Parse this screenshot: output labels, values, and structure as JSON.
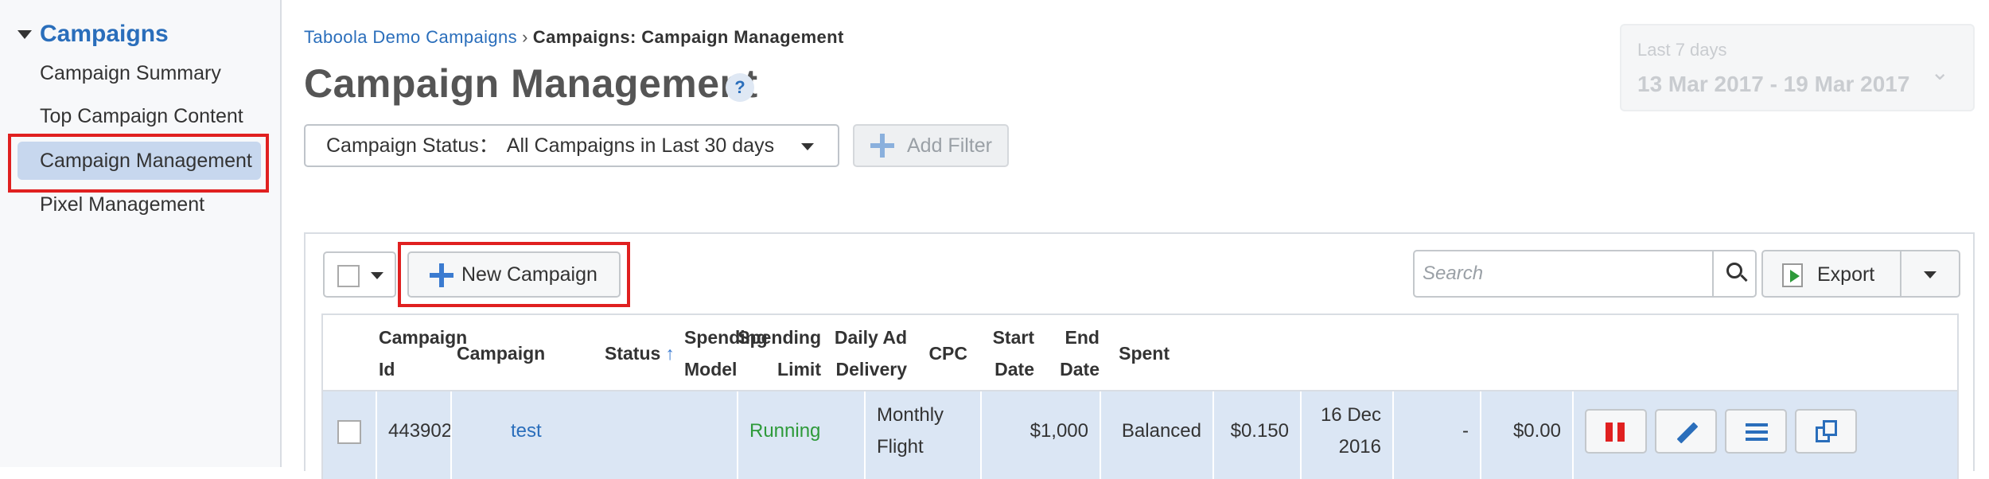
{
  "sidebar": {
    "title": "Campaigns",
    "items": [
      {
        "label": "Campaign Summary",
        "active": false
      },
      {
        "label": "Top Campaign Content",
        "active": false
      },
      {
        "label": "Campaign Management",
        "active": true
      },
      {
        "label": "Pixel Management",
        "active": false
      }
    ]
  },
  "breadcrumb": {
    "parent": "Taboola Demo Campaigns",
    "separator": "›",
    "current": "Campaigns: Campaign Management"
  },
  "page": {
    "title": "Campaign Management",
    "help": "?"
  },
  "date_range": {
    "label": "Last 7 days",
    "value": "13 Mar 2017 - 19 Mar 2017"
  },
  "filters": {
    "status_label": "Campaign Status：",
    "status_value": "All Campaigns in Last 30 days",
    "add_filter": "Add Filter"
  },
  "toolbar": {
    "new_campaign": "New Campaign",
    "search_placeholder": "Search",
    "export": "Export"
  },
  "table": {
    "headers": {
      "campaign_id": [
        "Campaign",
        "Id"
      ],
      "campaign": "Campaign",
      "status": "Status",
      "spending_model": [
        "Spending",
        "Model"
      ],
      "spending_limit": [
        "Spending",
        "Limit"
      ],
      "daily_ad_delivery": [
        "Daily Ad",
        "Delivery"
      ],
      "cpc": "CPC",
      "start_date": [
        "Start",
        "Date"
      ],
      "end_date": [
        "End",
        "Date"
      ],
      "spent": "Spent"
    },
    "rows": [
      {
        "campaign_id": "443902",
        "campaign": "test",
        "status": "Running",
        "spending_model": [
          "Monthly",
          "Flight"
        ],
        "spending_limit": "$1,000",
        "daily_ad_delivery": "Balanced",
        "cpc": "$0.150",
        "start_date": [
          "16 Dec",
          "2016"
        ],
        "end_date": "-",
        "spent": "$0.00"
      }
    ]
  },
  "colors": {
    "accent": "#2a6ebb",
    "highlight_red": "#e02020",
    "status_running": "#2e9a3a",
    "row_bg": "#dbe6f4"
  },
  "icons": [
    "triangle-down-icon",
    "help-icon",
    "chevron-down-icon",
    "plus-icon",
    "search-icon",
    "export-icon",
    "pause-icon",
    "pencil-icon",
    "list-icon",
    "copy-icon"
  ]
}
